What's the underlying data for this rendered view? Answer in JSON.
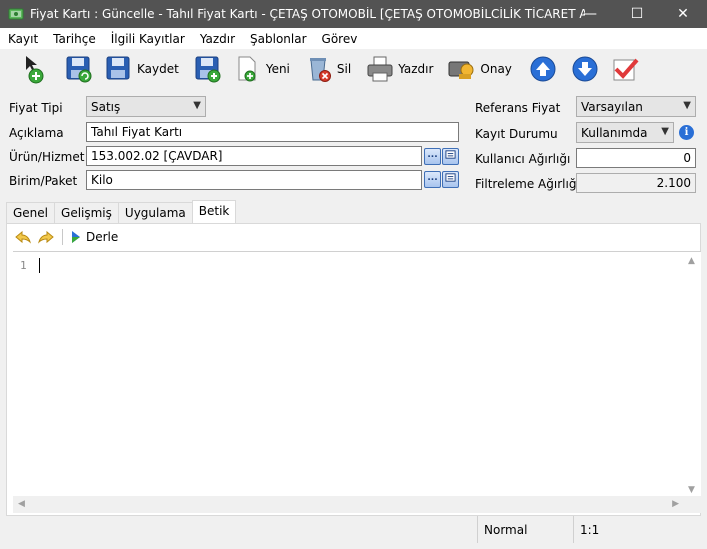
{
  "window": {
    "title": "Fiyat Kartı : Güncelle - Tahıl Fiyat Kartı - ÇETAŞ OTOMOBİL [ÇETAŞ OTOMOBİLCİLİK TİCARET ANONİ...",
    "minimize": "—",
    "maximize": "☐",
    "close": "✕"
  },
  "menu": [
    "Kayıt",
    "Tarihçe",
    "İlgili Kayıtlar",
    "Yazdır",
    "Şablonlar",
    "Görev"
  ],
  "toolbar": {
    "kaydet": "Kaydet",
    "yeni": "Yeni",
    "sil": "Sil",
    "yazdir": "Yazdır",
    "onay": "Onay"
  },
  "form": {
    "fiyat_tipi_label": "Fiyat Tipi",
    "fiyat_tipi_value": "Satış",
    "aciklama_label": "Açıklama",
    "aciklama_value": "Tahıl Fiyat Kartı",
    "urun_label": "Ürün/Hizmet",
    "urun_value": "153.002.02 [ÇAVDAR]",
    "birim_label": "Birim/Paket",
    "birim_value": "Kilo",
    "referans_label": "Referans Fiyat",
    "referans_value": "Varsayılan",
    "kayit_durumu_label": "Kayıt Durumu",
    "kayit_durumu_value": "Kullanımda",
    "kullanici_agirligi_label": "Kullanıcı Ağırlığı",
    "kullanici_agirligi_value": "0",
    "filtreleme_agirligi_label": "Filtreleme Ağırlığı",
    "filtreleme_agirligi_value": "2.100",
    "ellipsis": "...",
    "info": "i"
  },
  "tabs": [
    "Genel",
    "Gelişmiş",
    "Uygulama",
    "Betik"
  ],
  "script_panel": {
    "compile_label": "Derle",
    "line_number": "1"
  },
  "status": {
    "mode": "Normal",
    "position": "1:1"
  },
  "colors": {
    "titlebar": "#535353",
    "accent_blue": "#2a6fd6",
    "delete_red": "#d63a2a",
    "save_green": "#3aa83a"
  }
}
